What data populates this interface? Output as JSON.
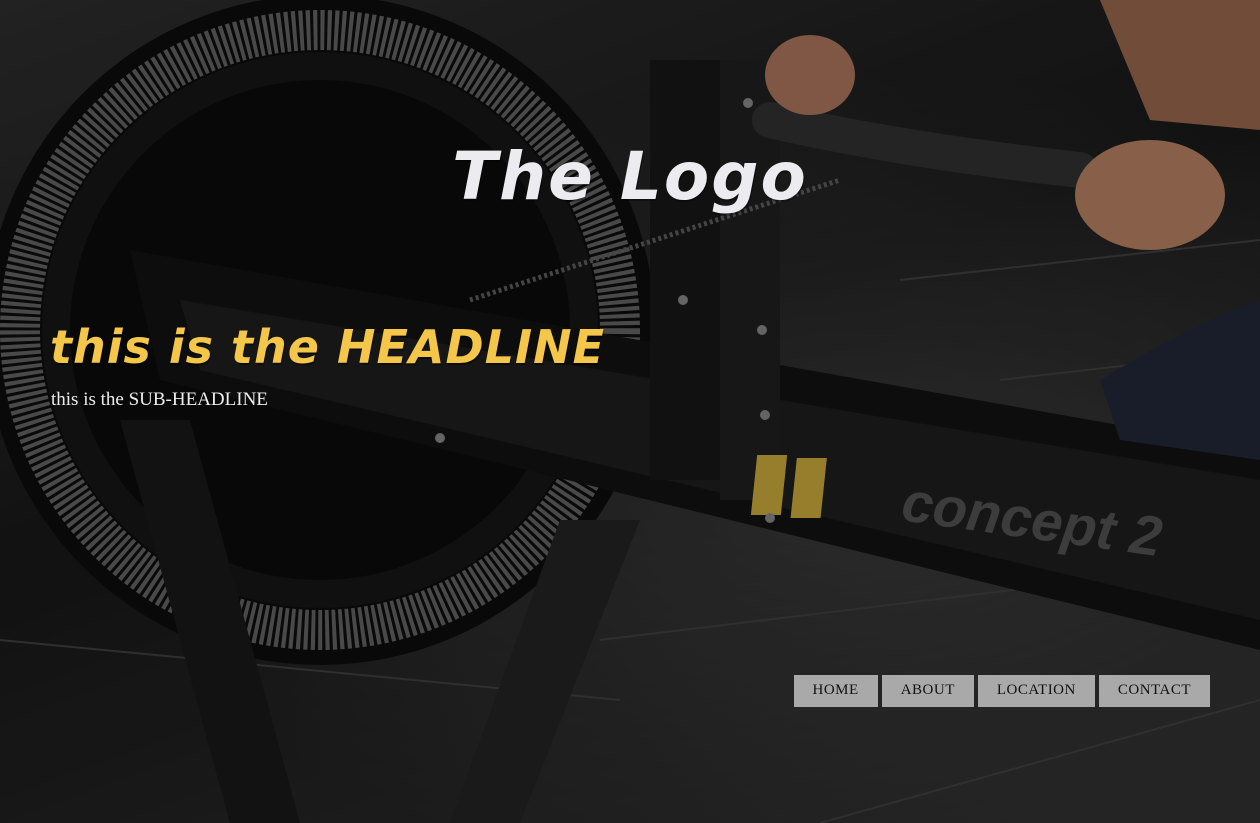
{
  "brand": {
    "logo_text": "The Logo"
  },
  "hero": {
    "headline": "this is the HEADLINE",
    "subheadline": "this is the SUB-HEADLINE",
    "equipment_label": "concept 2"
  },
  "nav": {
    "items": [
      {
        "label": "HOME"
      },
      {
        "label": "ABOUT"
      },
      {
        "label": "LOCATION"
      },
      {
        "label": "CONTACT"
      }
    ]
  },
  "colors": {
    "headline": "#f4c74a",
    "logo": "#ececf0",
    "nav_background": "#a9a9a9",
    "nav_text": "#111111"
  }
}
